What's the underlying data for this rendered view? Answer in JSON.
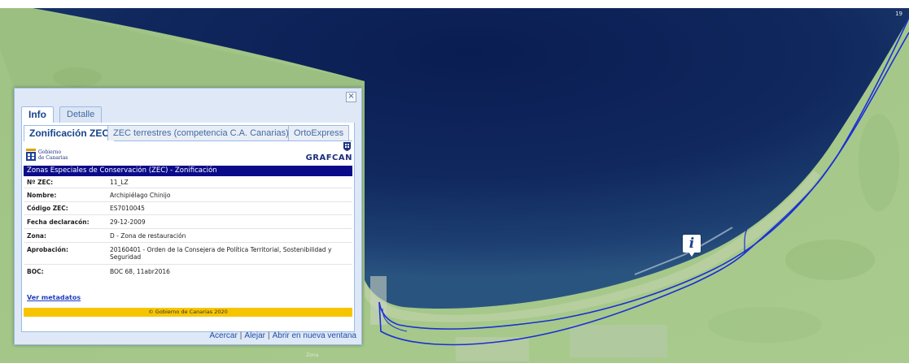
{
  "map": {
    "corner_label": "19",
    "place_label": "Zona",
    "marker_icon": "info-marker-icon",
    "colors": {
      "sea_dark": "#0a1f55",
      "sea_mid": "#1c3d73",
      "land": "#a8c98a",
      "boundary": "#1a2fd6"
    }
  },
  "popup": {
    "close_label": "×",
    "outer_tabs": [
      {
        "label": "Info",
        "active": true
      },
      {
        "label": "Detalle",
        "active": false
      }
    ],
    "inner_tabs": [
      {
        "label": "Zonificación ZEC",
        "active": true
      },
      {
        "label": "ZEC terrestres (competencia C.A. Canarias)",
        "active": false
      },
      {
        "label": "OrtoExpress",
        "active": false
      }
    ],
    "logos": {
      "gobierno_line1": "Gobierno",
      "gobierno_line2": "de Canarias",
      "grafcan": "GRAFCAN"
    },
    "section_title": "Zonas Especiales de Conservación (ZEC) - Zonificación",
    "fields": [
      {
        "key": "Nº ZEC:",
        "value": "11_LZ"
      },
      {
        "key": "Nombre:",
        "value": "Archipiélago Chinijo"
      },
      {
        "key": "Código ZEC:",
        "value": "ES7010045"
      },
      {
        "key": "Fecha declaracón:",
        "value": "29-12-2009"
      },
      {
        "key": "Zona:",
        "value": "D - Zona de restauración"
      },
      {
        "key": "Aprobación:",
        "value": "20160401 - Orden de la Consejera de Política Territorial, Sostenibilidad y Seguridad"
      },
      {
        "key": "BOC:",
        "value": "BOC 68, 11abr2016"
      }
    ],
    "metadata_link": "Ver metadatos",
    "footer": "© Gobierno de Canarias 2020",
    "actions": {
      "zoom_in": "Acercar",
      "zoom_out": "Alejar",
      "open_new": "Abrir en nueva ventana",
      "separator": "|"
    }
  }
}
